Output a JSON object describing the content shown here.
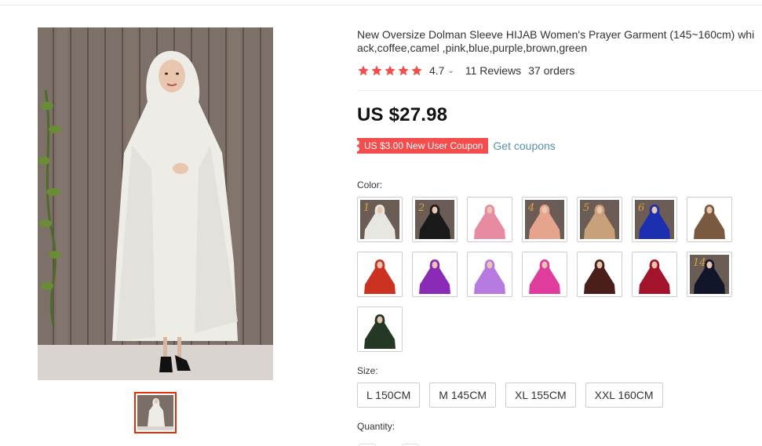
{
  "product": {
    "title_line1": "New Oversize Dolman Sleeve HIJAB Women's Prayer Garment (145~160cm) whi",
    "title_line2": "ack,coffee,camel ,pink,blue,purple,brown,green",
    "rating": "4.7",
    "reviews": "11 Reviews",
    "orders": "37 orders",
    "price": "US $27.98",
    "coupon": "US $3.00 New User Coupon",
    "get_coupons": "Get coupons"
  },
  "color_label": "Color:",
  "size_label": "Size:",
  "quantity_label": "Quantity:",
  "colors": [
    {
      "number": "1",
      "bg": "#6b5d55",
      "garment": "#e8e6e0"
    },
    {
      "number": "2",
      "bg": "#6b5d55",
      "garment": "#1a1a1a"
    },
    {
      "number": "",
      "bg": "#ffffff",
      "garment": "#e98aa3"
    },
    {
      "number": "4",
      "bg": "#6b5d55",
      "garment": "#e7a48c"
    },
    {
      "number": "5",
      "bg": "#6b5d55",
      "garment": "#c8a07a"
    },
    {
      "number": "6",
      "bg": "#6b5d55",
      "garment": "#1b2fb0"
    },
    {
      "number": "",
      "bg": "#ffffff",
      "garment": "#7a5a3e"
    },
    {
      "number": "",
      "bg": "#ffffff",
      "garment": "#cc3222"
    },
    {
      "number": "",
      "bg": "#ffffff",
      "garment": "#8a2bb8"
    },
    {
      "number": "",
      "bg": "#ffffff",
      "garment": "#b57be0"
    },
    {
      "number": "",
      "bg": "#ffffff",
      "garment": "#e03c9e"
    },
    {
      "number": "",
      "bg": "#ffffff",
      "garment": "#4a1e1a"
    },
    {
      "number": "",
      "bg": "#ffffff",
      "garment": "#a3142c"
    },
    {
      "number": "14",
      "bg": "#6b5d55",
      "garment": "#12162a"
    },
    {
      "number": "",
      "bg": "#ffffff",
      "garment": "#243826"
    }
  ],
  "sizes": [
    "L 150CM",
    "M 145CM",
    "XL 155CM",
    "XXL 160CM"
  ],
  "colors_theme": {
    "accent_red": "#e62e04",
    "coupon_red": "#f44d4d",
    "star": "#f44d4d",
    "link": "#5a8fb0"
  }
}
